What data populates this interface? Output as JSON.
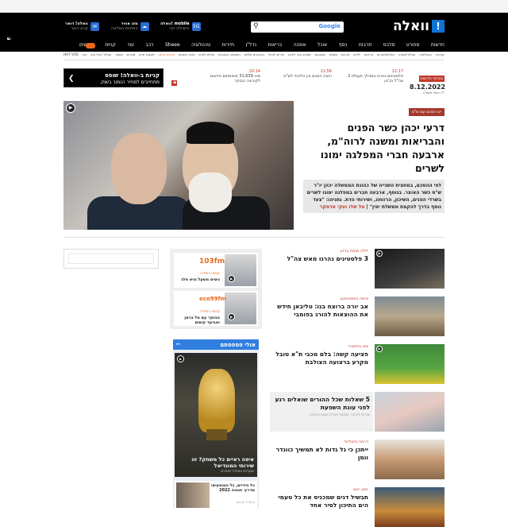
{
  "header": {
    "logo_text": "וואלה",
    "logo_mark": "!",
    "search_brand": "Google",
    "services": [
      {
        "title": "וואלה! דואר",
        "sub": "קרא דואר",
        "icon": "mail-icon"
      },
      {
        "title": "מזג אוויר",
        "sub": "התחזית המלאה",
        "icon": "weather-icon"
      },
      {
        "title": "וואלה! mobile",
        "sub": "החבילה הכי",
        "icon": "mobile-icon"
      }
    ]
  },
  "nav": {
    "items": [
      "חדשות",
      "ספורט",
      "סלבס",
      "תרבות",
      "כסף",
      "אוכל",
      "אופנה",
      "בריאות",
      "נדל\"ן",
      "תיירות",
      "טכנולוגיה",
      "Sheee",
      "רכב",
      "עוד",
      "קניות",
      "דרושים"
    ]
  },
  "subnav": {
    "items": [
      "קורונה",
      "טכנולוגיה",
      "וואלה!אופנה",
      "מחלות/הורים",
      "בריאות",
      "ילדים",
      "תרבות",
      "משפט",
      "מבצעים",
      "שופינג אנד ליבינג",
      "הורים לגדול",
      "האהובים שלכם",
      "השופינג המבטיח",
      "טיפים לחיים",
      "פתח הזמנות",
      "גורמת אותנו",
      "תקציב חדש",
      "ספרים",
      "משבר",
      "וואלה! מזל טוב",
      "יוגה",
      "HOT VOD"
    ],
    "highlight_index": 15
  },
  "newsbar": {
    "label": "מבזקי חדשות",
    "date": "8.12.2022",
    "hebrew_date": "י\"ד כסלו תשפ\"ג",
    "items": [
      {
        "time": "12:17",
        "text": "2 פלסטינים נהרגו במהלך פעולת צה\"ל בג'נין"
      },
      {
        "time": "11:56",
        "text": "רואה הסכם בין הליכוד לש\"ס"
      },
      {
        "time": "10:14",
        "text": "מיני 31,639 מאומתים חדשים לקורונה הבוקר"
      }
    ]
  },
  "promo": {
    "line1": "קניות ב-וואלה! שופס",
    "line2": "מתחייבים למחיר הנמוך בשוק"
  },
  "hero": {
    "kicker": "יש הסכם עם ש\"ס",
    "title": "דרעי יכהן כשר הפנים והבריאות ומשנה לרוה\"מ, ארבעה חברי המפלגה ימונו לשרים",
    "summary": "לפי ההסכם, במחצית השנייה של כהונת הממשלה יכהן יו\"ר ש\"ס כשר האוצר. בנוסף, ארבעה חברים במפלגה ימונו לשרים בשרדי הפנים, השיכון, הרווחה, ושירותי הדת. נתניהו: \"צעד נוסף בדרך להקמת ממשלת ימין\"",
    "author": "טל שלו ועקי אדמקר"
  },
  "articles": [
    {
      "kicker": "לילה מתוח בג'נין",
      "title": "3 פלסטינים נהרגו מאש צה\"ל",
      "sub": ""
    },
    {
      "kicker": "אימה באפגניסטן",
      "title": "אב יורה ברוצח בנו: טליבאן חידש את ההוצאות להורג בפומבי",
      "sub": ""
    },
    {
      "kicker": "צפו בתקציר",
      "title": "פציעה קשה: בלם מכבי ת\"א טובל מקרע ברצועה הצולבת",
      "sub": ""
    },
    {
      "kicker": "",
      "title": "5 שאלות שכל ההורים שואלים רגע לפני עונת השפעת",
      "sub": "שירות לציבור מטעם חברת אסטרהזנקה"
    },
    {
      "kicker": "דרמה בהוליווד",
      "title": "ייתכן כי גל גדות לא תמשיך כוונדר וומן",
      "sub": ""
    },
    {
      "kicker": "יאם, יאם",
      "title": "תבשיל דגים שמכניס את כל טעמי הים התיכון לסיר אחד",
      "sub": ""
    }
  ],
  "radio": {
    "items": [
      {
        "brand": "103fm",
        "category": "עכשיו בשידור",
        "title": "ניסים משעל וגיא פלג"
      },
      {
        "brand": "eco99fm",
        "category": "עכשיו בשידור",
        "title": "הבוקר עם טל ברמן ואביעד קיסוס"
      }
    ]
  },
  "olay": {
    "title": "אולי פספסתם",
    "video_title": "איפה ראיים כל משחק? זה שירותי המונדיאל",
    "video_sub": "מערכת וואלה! ספורט",
    "small_title": "כל הידיים, כל המופעים: מדריך חנוכה 2022",
    "small_sub": "וואלה! תרבות"
  },
  "colors": {
    "brand_blue": "#0e73d9",
    "accent_red": "#c0392b",
    "accent_orange": "#e8671b"
  }
}
